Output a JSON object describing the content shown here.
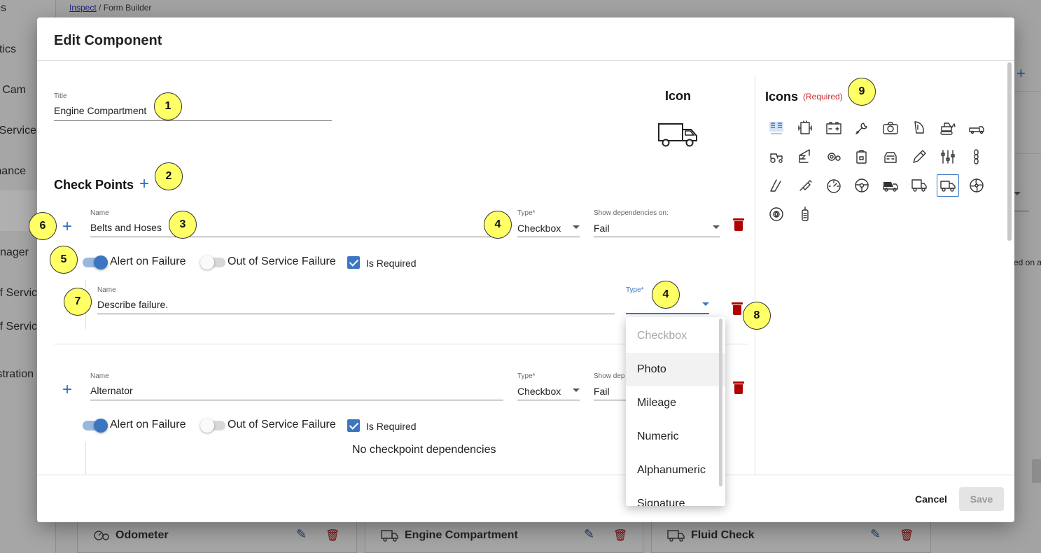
{
  "background": {
    "breadcrumb": {
      "link": "Inspect",
      "separator": "/",
      "current": "Form Builder"
    },
    "sidebar_items": [
      "es",
      "tics",
      "Cam",
      "Service",
      "nance",
      "anager",
      "f Servic",
      "f Servic",
      "stration"
    ],
    "right_text": "ed on a",
    "cards": [
      {
        "label": "Odometer",
        "icon": "odometer-icon"
      },
      {
        "label": "Engine Compartment",
        "icon": "truck-icon"
      },
      {
        "label": "Fluid Check",
        "icon": "truck-icon"
      }
    ]
  },
  "modal": {
    "title": "Edit Component",
    "title_field": {
      "label": "Title",
      "value": "Engine Compartment"
    },
    "icon_label": "Icon",
    "icons_label": "Icons",
    "icons_required": "(Required)",
    "check_points_label": "Check Points",
    "checkpoints": [
      {
        "name_label": "Name",
        "name": "Belts and Hoses",
        "type_label": "Type*",
        "type": "Checkbox",
        "deps_label": "Show dependencies on:",
        "deps": "Fail",
        "alert_label": "Alert on Failure",
        "alert_on": true,
        "oos_label": "Out of Service Failure",
        "oos_on": false,
        "required_label": "Is Required",
        "required": true,
        "sub": {
          "name_label": "Name",
          "name": "Describe failure.",
          "type_label": "Type*",
          "type": ""
        }
      },
      {
        "name_label": "Name",
        "name": "Alternator",
        "type_label": "Type*",
        "type": "Checkbox",
        "deps_label": "Show dep",
        "deps": "Fail",
        "alert_label": "Alert on Failure",
        "alert_on": true,
        "oos_label": "Out of Service Failure",
        "oos_on": false,
        "required_label": "Is Required",
        "required": true,
        "no_deps": "No checkpoint dependencies"
      }
    ],
    "type_menu": [
      "Checkbox",
      "Photo",
      "Mileage",
      "Numeric",
      "Alphanumeric",
      "Signature"
    ],
    "cancel_label": "Cancel",
    "save_label": "Save"
  },
  "icons": [
    "intellishift-logo-icon",
    "engine-icon",
    "battery-icon",
    "wrench-icon",
    "camera-icon",
    "mirror-icon",
    "excavator-icon",
    "flatbed-truck-icon",
    "tractor-icon",
    "crane-icon",
    "gears-icon",
    "fuel-can-icon",
    "cab-icon",
    "pencil-icon",
    "equalizer-icon",
    "chain-icon",
    "wipers-icon",
    "spark-plug-icon",
    "speedometer-icon",
    "steering-wheel-icon",
    "dump-truck-icon",
    "box-truck-icon",
    "delivery-truck-icon",
    "fan-icon",
    "turbo-icon",
    "radio-icon"
  ],
  "selected_icon": "delivery-truck-icon",
  "annotations": [
    "1",
    "2",
    "3",
    "4",
    "5",
    "6",
    "7",
    "4",
    "8",
    "9"
  ],
  "colors": {
    "accent": "#3b76c0",
    "delete": "#b00000",
    "required": "#c62828",
    "badge": "#ffff66"
  }
}
